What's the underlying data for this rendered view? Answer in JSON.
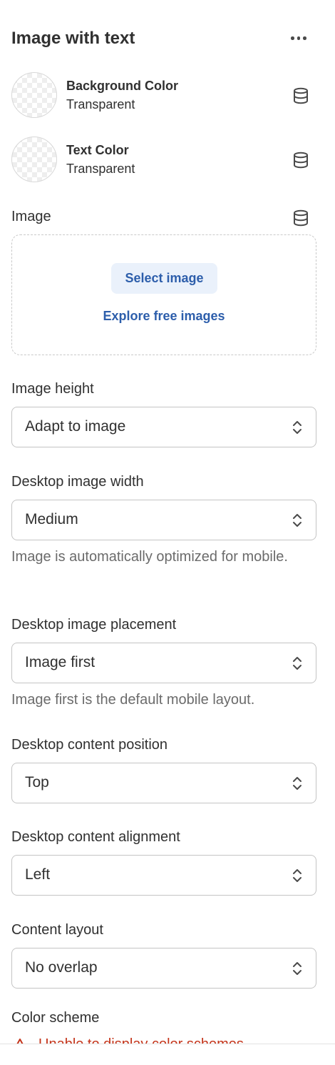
{
  "header": {
    "title": "Image with text",
    "more_icon": "ellipsis-horizontal-icon"
  },
  "colors": {
    "background": {
      "name": "Background Color",
      "value": "Transparent",
      "icon": "dynamic-source-database-icon"
    },
    "text": {
      "name": "Text Color",
      "value": "Transparent",
      "icon": "dynamic-source-database-icon"
    }
  },
  "image": {
    "label": "Image",
    "select_label": "Select image",
    "explore_label": "Explore free images"
  },
  "fields": {
    "image_height": {
      "label": "Image height",
      "value": "Adapt to image"
    },
    "desktop_image_width": {
      "label": "Desktop image width",
      "value": "Medium",
      "help": "Image is automatically optimized for mobile."
    },
    "desktop_image_placement": {
      "label": "Desktop image placement",
      "value": "Image first",
      "help": "Image first is the default mobile layout."
    },
    "desktop_content_position": {
      "label": "Desktop content position",
      "value": "Top"
    },
    "desktop_content_alignment": {
      "label": "Desktop content alignment",
      "value": "Left"
    },
    "content_layout": {
      "label": "Content layout",
      "value": "No overlap"
    },
    "color_scheme": {
      "label": "Color scheme",
      "error": "Unable to display color schemes"
    }
  },
  "theme": {
    "accent": "#2d5eab",
    "error": "#c4341a",
    "text": "#303030",
    "muted": "#6b6b6b"
  }
}
